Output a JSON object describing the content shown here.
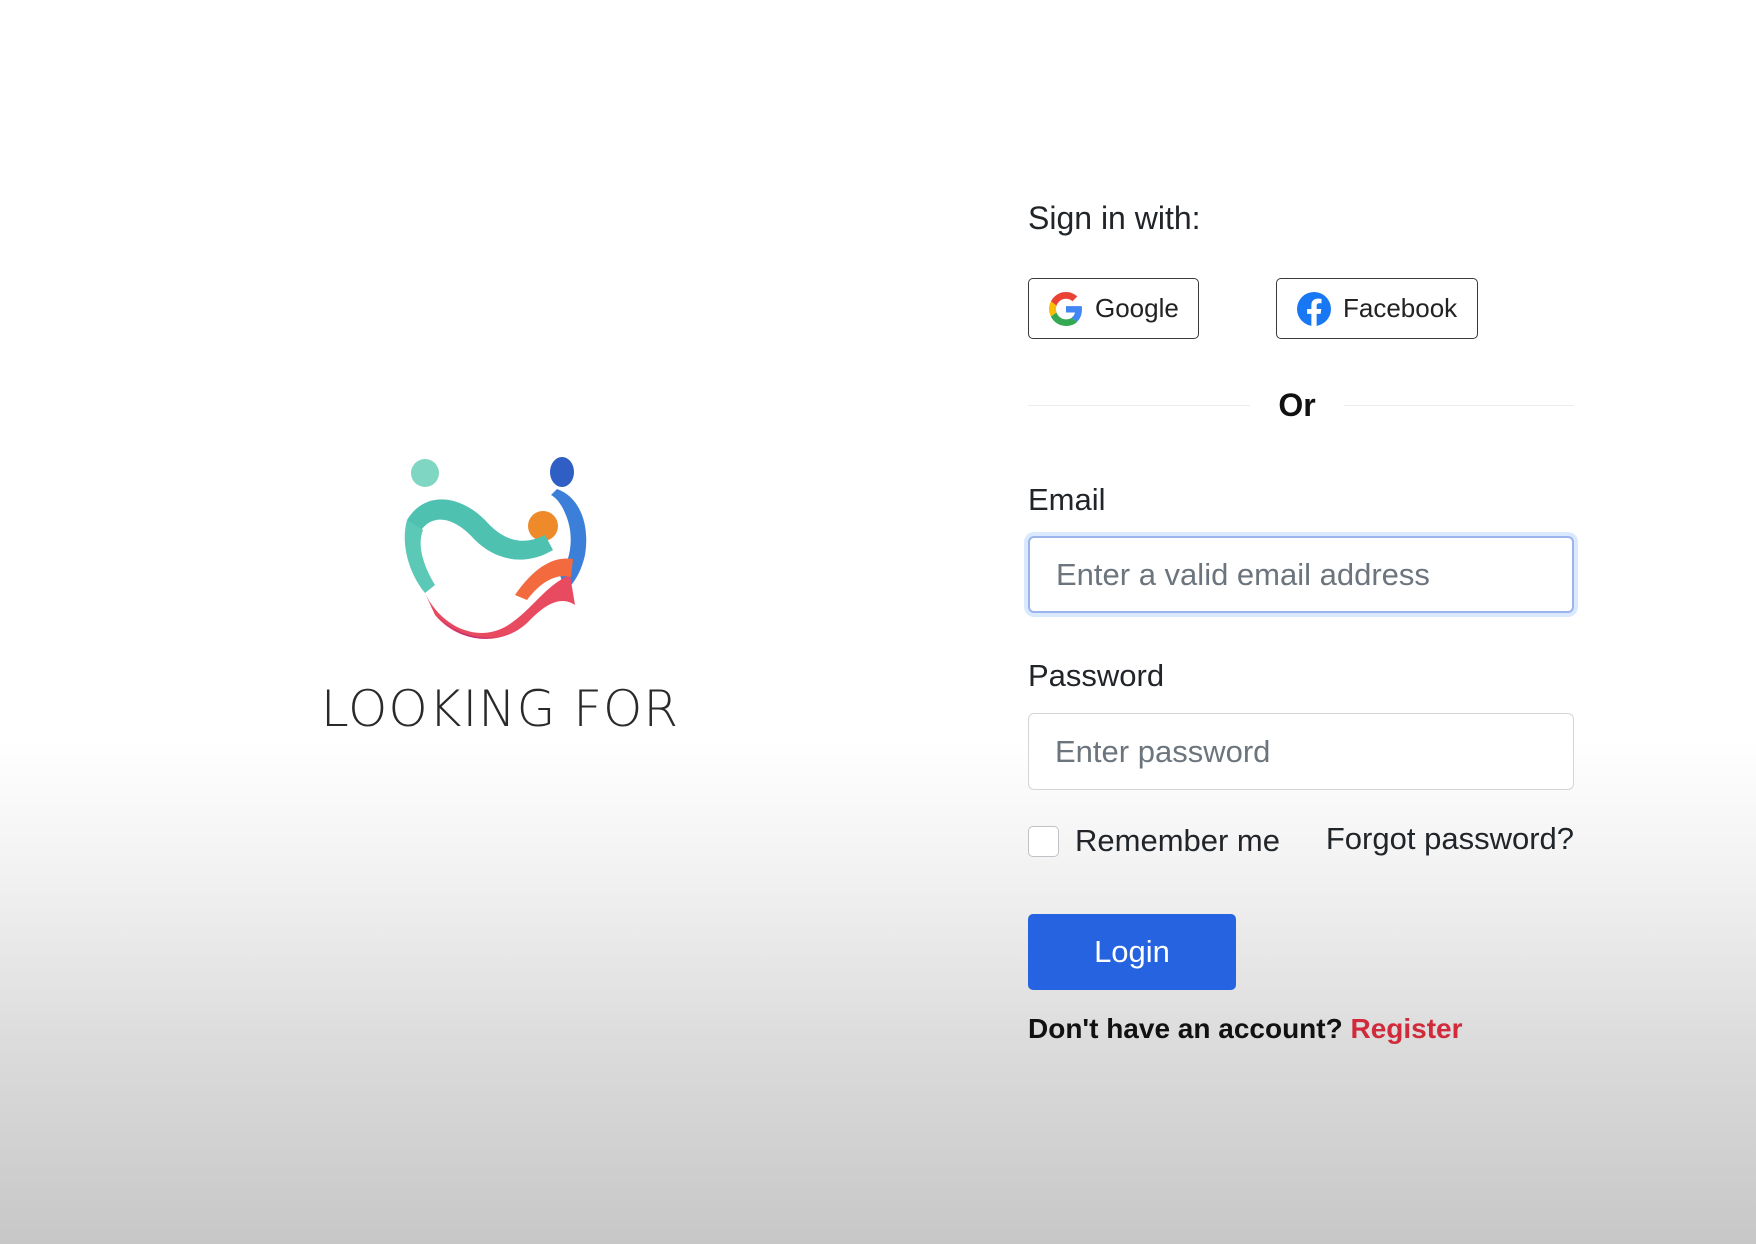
{
  "brand": {
    "name": "LOOKING FOR"
  },
  "signin": {
    "label": "Sign in with:",
    "google_label": "Google",
    "facebook_label": "Facebook",
    "divider_text": "Or"
  },
  "form": {
    "email_label": "Email",
    "email_placeholder": "Enter a valid email address",
    "password_label": "Password",
    "password_placeholder": "Enter password",
    "remember_label": "Remember me",
    "forgot_label": "Forgot password?",
    "login_label": "Login",
    "no_account_text": "Don't have an account?",
    "register_label": "Register"
  },
  "colors": {
    "primary": "#2563e0",
    "register_link": "#d12b3b",
    "focus_ring": "#9bb4ec"
  },
  "icons": {
    "google": "google-icon",
    "facebook": "facebook-icon",
    "logo": "looking-for-logo"
  }
}
